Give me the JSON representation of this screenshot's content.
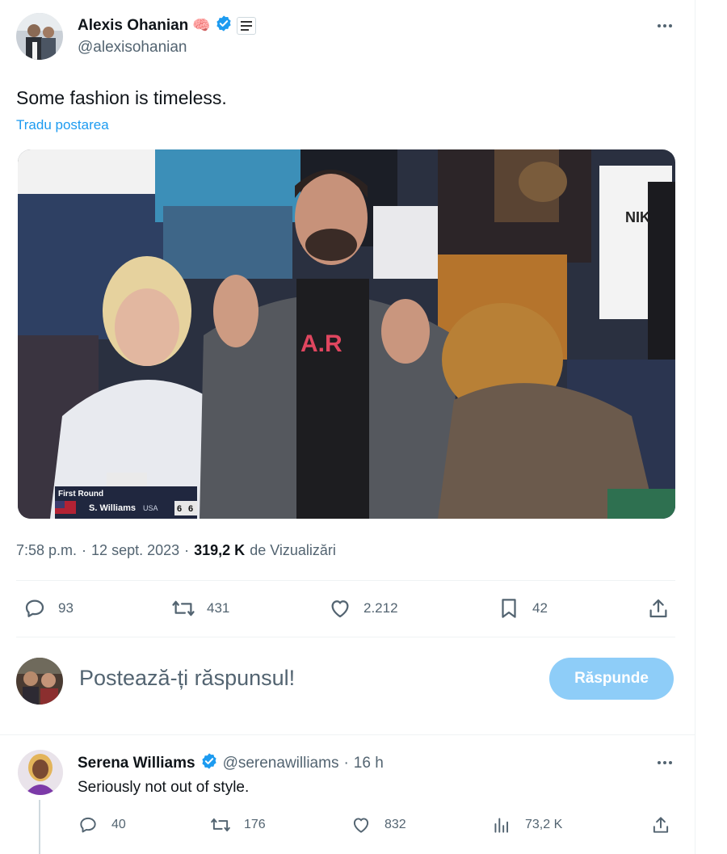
{
  "post": {
    "author_name": "Alexis Ohanian",
    "author_emoji": "🧠",
    "handle": "@alexisohanian",
    "text": "Some fashion is timeless.",
    "translate": "Tradu postarea",
    "time": "7:58 p.m.",
    "date": "12 sept. 2023",
    "views_count": "319,2 K",
    "views_label": "de Vizualizări",
    "separator": "·",
    "stats": {
      "replies": "93",
      "reposts": "431",
      "likes": "2.212",
      "bookmarks": "42"
    },
    "media": {
      "scoreboard_round": "First Round",
      "scoreboard_player": "S. Williams",
      "scoreboard_country": "USA",
      "scoreboard_set1": "6",
      "scoreboard_set2": "6",
      "shirt_text": "A.R",
      "cap_text": "NIK"
    }
  },
  "reply_box": {
    "placeholder": "Postează-ți răspunsul!",
    "button_label": "Răspunde",
    "button_color": "#8ecdf8"
  },
  "reply": {
    "author_name": "Serena Williams",
    "handle": "@serenawilliams",
    "separator": "·",
    "time": "16 h",
    "text": "Seriously not out of style.",
    "stats": {
      "replies": "40",
      "reposts": "176",
      "likes": "832",
      "views": "73,2 K"
    }
  },
  "colors": {
    "verified": "#1d9bf0",
    "link": "#1d9bf0",
    "muted": "#536471",
    "divider": "#eff3f4"
  }
}
